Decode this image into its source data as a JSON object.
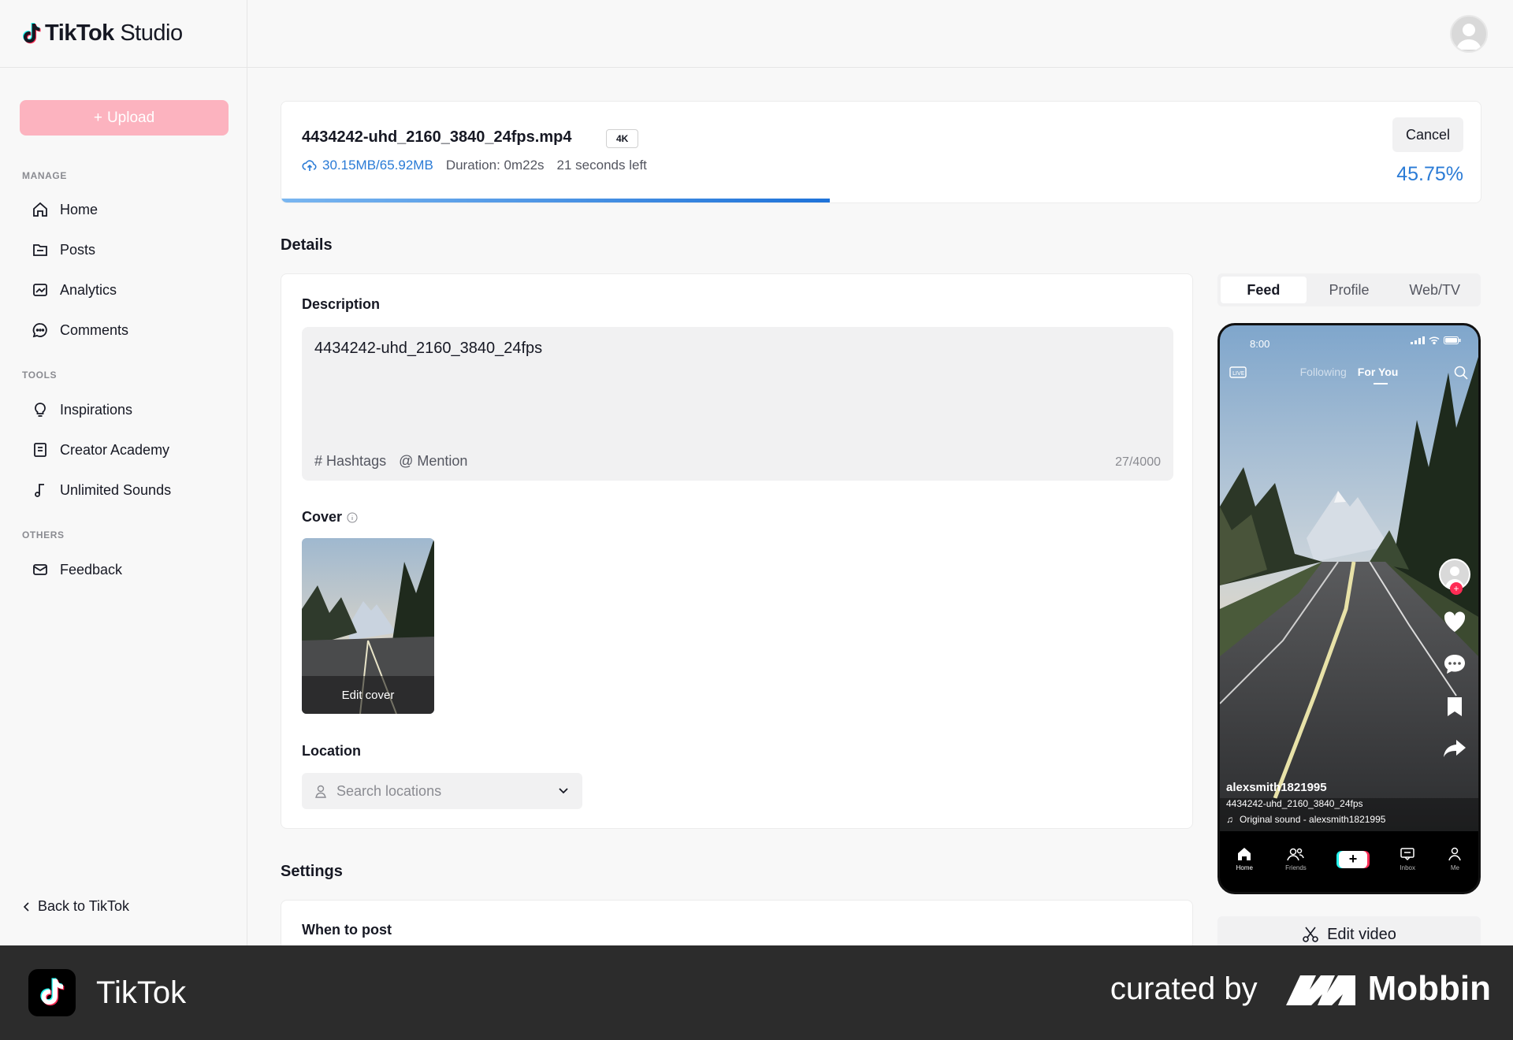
{
  "app": {
    "logo_text": "TikTok",
    "logo_suffix": "Studio"
  },
  "sidebar": {
    "upload_label": "Upload",
    "sections": {
      "manage": "MANAGE",
      "tools": "TOOLS",
      "others": "OTHERS"
    },
    "items": [
      {
        "label": "Home",
        "icon": "home-icon"
      },
      {
        "label": "Posts",
        "icon": "posts-icon"
      },
      {
        "label": "Analytics",
        "icon": "analytics-icon"
      },
      {
        "label": "Comments",
        "icon": "comments-icon"
      },
      {
        "label": "Inspirations",
        "icon": "lightbulb-icon"
      },
      {
        "label": "Creator Academy",
        "icon": "book-icon"
      },
      {
        "label": "Unlimited Sounds",
        "icon": "music-note-icon"
      },
      {
        "label": "Feedback",
        "icon": "mail-icon"
      }
    ],
    "back_label": "Back to TikTok"
  },
  "upload": {
    "file_name": "4434242-uhd_2160_3840_24fps.mp4",
    "badge": "4K",
    "progress_text": "30.15MB/65.92MB",
    "duration": "Duration: 0m22s",
    "time_left": "21 seconds left",
    "cancel_label": "Cancel",
    "percent": "45.75%",
    "progress_fraction": 0.4575
  },
  "details": {
    "heading": "Details",
    "description_label": "Description",
    "description_value": "4434242-uhd_2160_3840_24fps",
    "hashtags_label": "Hashtags",
    "mention_label": "Mention",
    "char_count": "27/4000",
    "cover_label": "Cover",
    "edit_cover_label": "Edit cover",
    "location_label": "Location",
    "location_placeholder": "Search locations"
  },
  "settings": {
    "heading": "Settings",
    "when_to_post_label": "When to post"
  },
  "preview": {
    "tabs": [
      "Feed",
      "Profile",
      "Web/TV"
    ],
    "active_tab": "Feed",
    "phone": {
      "time": "8:00",
      "following": "Following",
      "for_you": "For You",
      "username": "alexsmith1821995",
      "caption": "4434242-uhd_2160_3840_24fps",
      "sound": "Original sound - alexsmith1821995",
      "bottom_nav": [
        "Home",
        "Friends",
        "Inbox",
        "Me"
      ]
    },
    "edit_video_label": "Edit video"
  },
  "footer": {
    "app_name": "TikTok",
    "curated_by": "curated by",
    "brand": "Mobbin"
  },
  "colors": {
    "accent_pink": "#fe2c55",
    "upload_button_disabled": "#fcb3bf",
    "progress_blue": "#1f73d9",
    "footer_bg": "#2c2c2c"
  }
}
